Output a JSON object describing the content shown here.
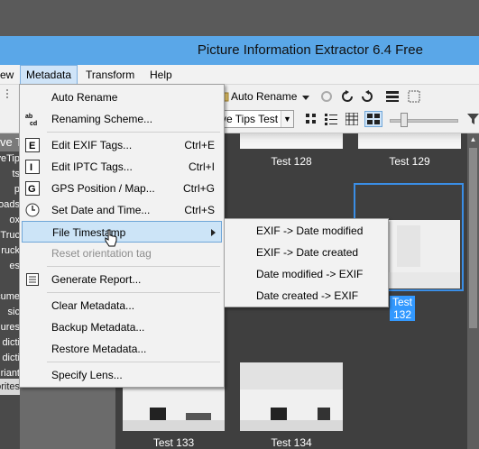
{
  "window": {
    "title": "Picture Information Extractor 6.4 Free"
  },
  "menubar": {
    "items": [
      {
        "label": "ew"
      },
      {
        "label": "Metadata"
      },
      {
        "label": "Transform"
      },
      {
        "label": "Help"
      }
    ]
  },
  "toolbar": {
    "auto_rename_label": "Auto Rename",
    "preset_select": "ve Tips Test"
  },
  "left_panel": {
    "header": "ve Ti",
    "rows": [
      "veTip",
      "ts",
      "p",
      "oads",
      "ox",
      "Truc",
      "ruck",
      "es",
      "",
      "cume",
      "sic",
      "ures",
      "dicti",
      "dicti",
      "riant"
    ],
    "bottom_tab": "orites"
  },
  "metadata_menu": {
    "items": [
      {
        "label": "Auto Rename",
        "shortcut": "",
        "icon": ""
      },
      {
        "label": "Renaming Scheme...",
        "shortcut": "",
        "icon": "abcd-icon"
      },
      {
        "label": "Edit EXIF Tags...",
        "shortcut": "Ctrl+E",
        "icon": "exif-icon"
      },
      {
        "label": "Edit IPTC Tags...",
        "shortcut": "Ctrl+I",
        "icon": "iptc-icon"
      },
      {
        "label": "GPS Position / Map...",
        "shortcut": "Ctrl+G",
        "icon": "gps-icon"
      },
      {
        "label": "Set Date and Time...",
        "shortcut": "Ctrl+S",
        "icon": "clock-icon"
      },
      {
        "label": "File Timestamp",
        "shortcut": "",
        "icon": ""
      },
      {
        "label": "Reset orientation tag",
        "shortcut": "",
        "icon": ""
      },
      {
        "label": "Generate Report...",
        "shortcut": "",
        "icon": "report-icon"
      },
      {
        "label": "Clear Metadata...",
        "shortcut": "",
        "icon": ""
      },
      {
        "label": "Backup Metadata...",
        "shortcut": "",
        "icon": ""
      },
      {
        "label": "Restore Metadata...",
        "shortcut": "",
        "icon": ""
      },
      {
        "label": "Specify Lens...",
        "shortcut": "",
        "icon": ""
      }
    ]
  },
  "timestamp_submenu": {
    "items": [
      {
        "label": "EXIF -> Date modified"
      },
      {
        "label": "EXIF -> Date created"
      },
      {
        "label": "Date modified -> EXIF"
      },
      {
        "label": "Date created -> EXIF"
      }
    ]
  },
  "gallery": {
    "thumbnails": [
      {
        "label": "Test 128"
      },
      {
        "label": "Test 129"
      },
      {
        "label": "Test 132"
      },
      {
        "label": "Test 133"
      },
      {
        "label": "Test 134"
      }
    ]
  },
  "colors": {
    "title_bar": "#5aa7e8",
    "menu_highlight": "#cce4f7",
    "selection": "#3399ff"
  }
}
